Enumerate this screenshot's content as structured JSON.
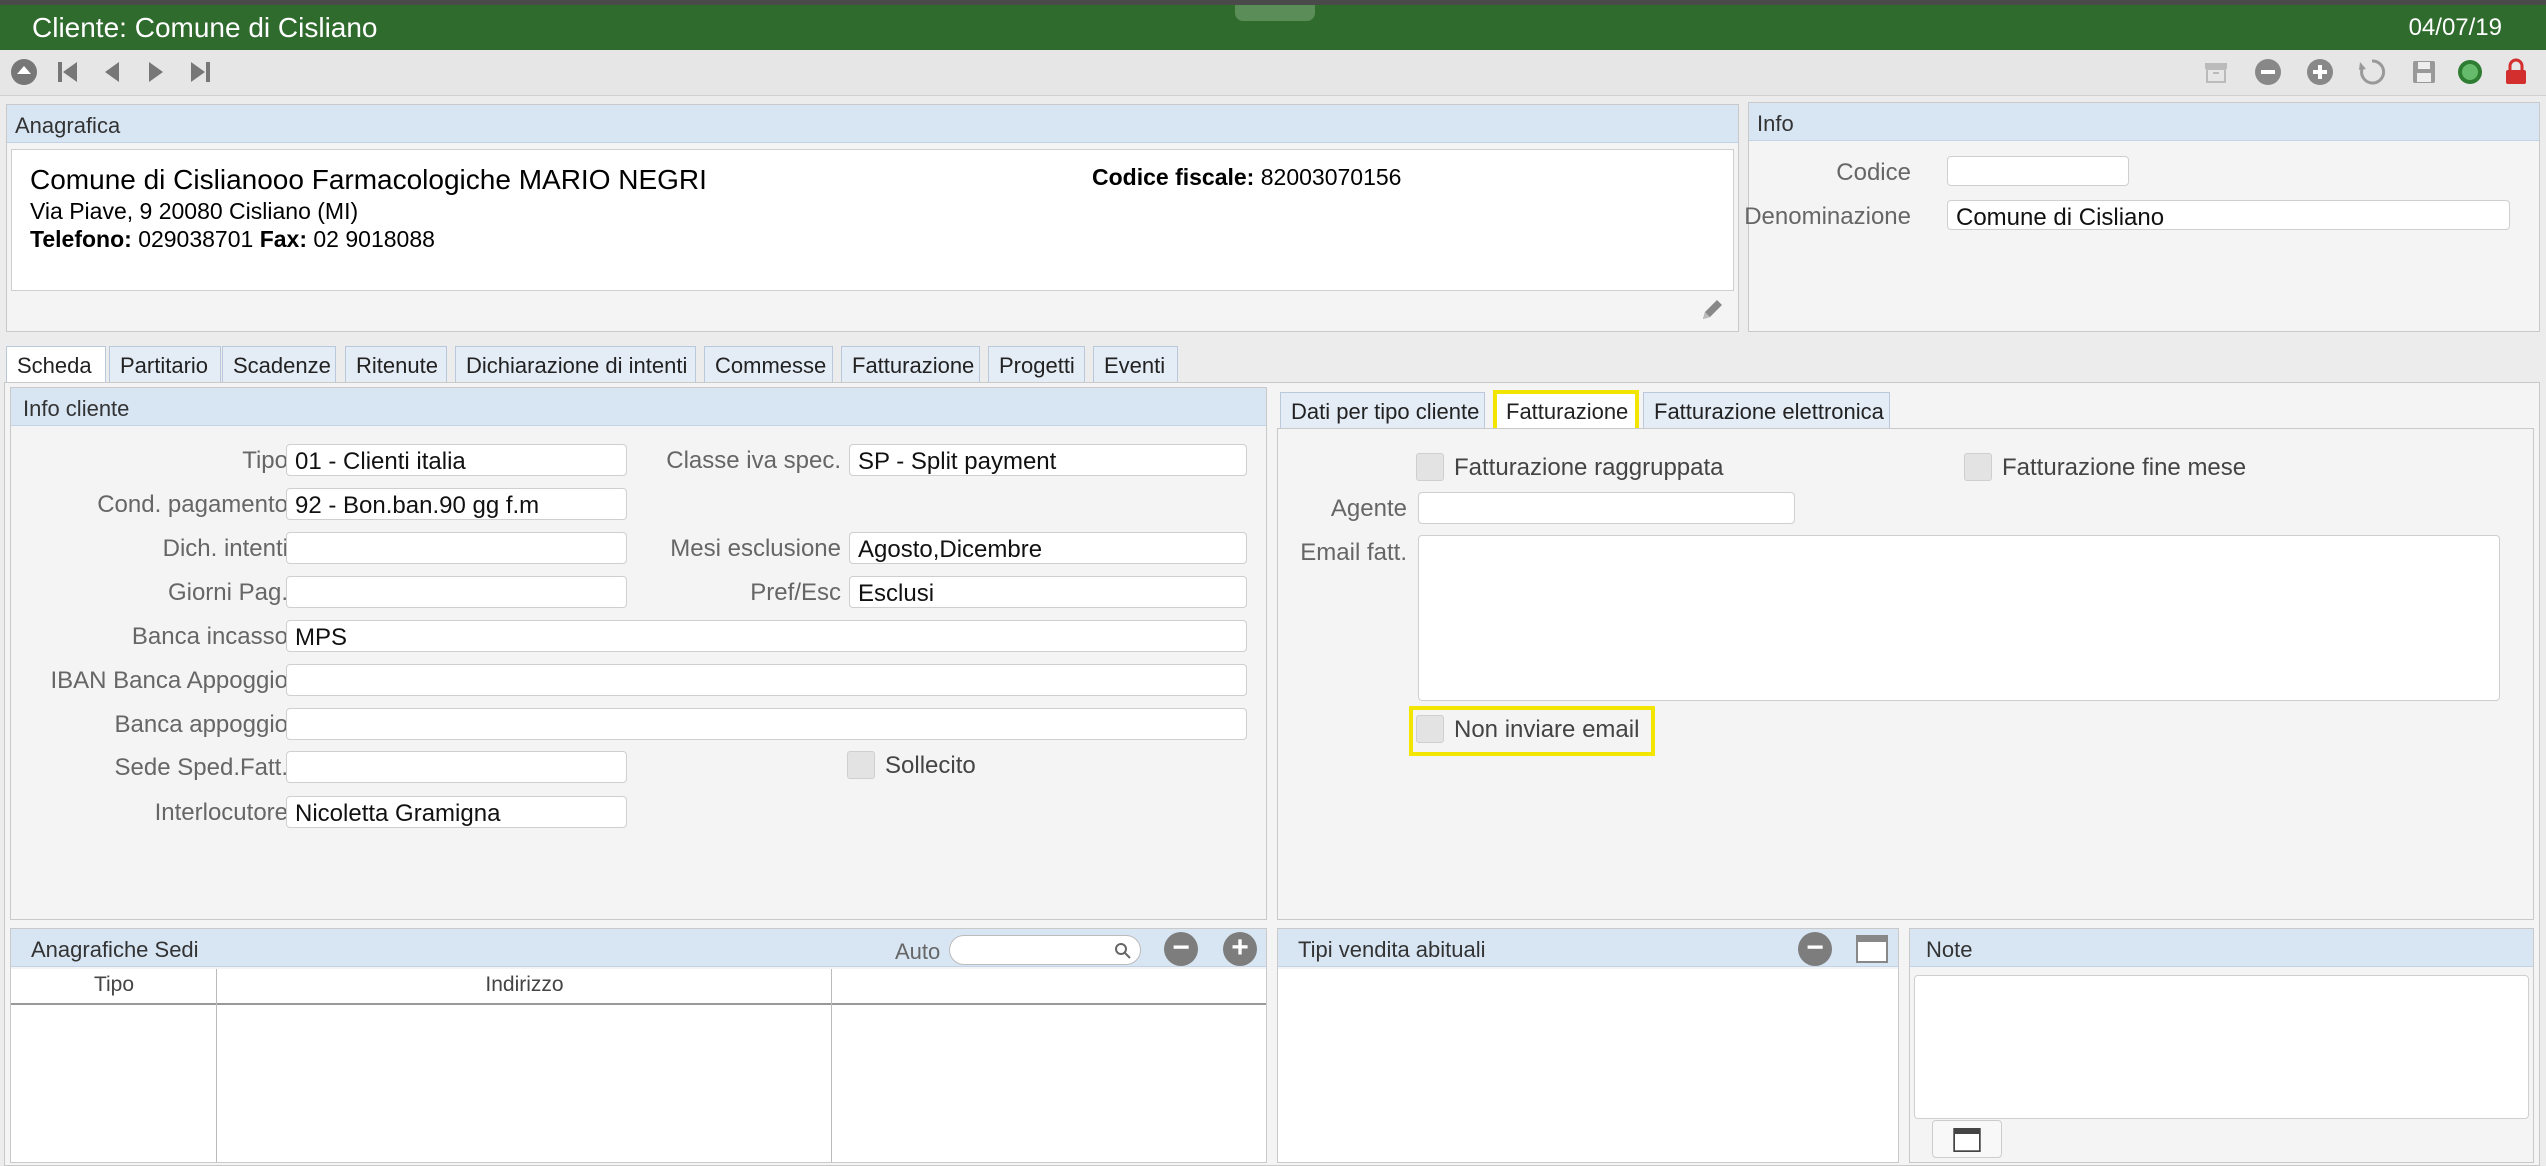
{
  "window": {
    "title": "Cliente: Comune di Cisliano",
    "date": "04/07/19"
  },
  "toolbar": {
    "nav_icons": [
      "home-icon",
      "first-record-icon",
      "previous-record-icon",
      "next-record-icon",
      "last-record-icon"
    ],
    "action_icons": [
      "archive-icon",
      "remove-icon",
      "add-icon",
      "refresh-icon",
      "save-icon",
      "status-icon",
      "lock-icon"
    ],
    "status_color": "#4caf50",
    "lock_color": "#d32f2f"
  },
  "anagrafica": {
    "header": "Anagrafica",
    "name": "Comune di Cislianooo Farmacologiche MARIO NEGRI",
    "address": "Via Piave, 9 20080 Cisliano (MI)",
    "tel_label": "Telefono:",
    "tel_value": "029038701",
    "fax_label": "Fax:",
    "fax_value": "02 9018088",
    "cf_label": "Codice fiscale:",
    "cf_value": "82003070156"
  },
  "info": {
    "header": "Info",
    "codice_label": "Codice",
    "codice_value": "",
    "denominazione_label": "Denominazione",
    "denominazione_value": "Comune di Cisliano"
  },
  "tabs": [
    "Scheda",
    "Partitario",
    "Scadenze",
    "Ritenute",
    "Dichiarazione di intenti",
    "Commesse",
    "Fatturazione",
    "Progetti",
    "Eventi"
  ],
  "info_cliente": {
    "header": "Info cliente",
    "tipo_label": "Tipo",
    "tipo_value": "01 - Clienti italia",
    "classe_label": "Classe iva spec.",
    "classe_value": "SP - Split payment",
    "cond_label": "Cond. pagamento",
    "cond_value": "92 - Bon.ban.90 gg f.m",
    "dich_label": "Dich. intenti",
    "dich_value": "",
    "mesi_label": "Mesi esclusione",
    "mesi_value": "Agosto,Dicembre",
    "giorni_label": "Giorni Pag.",
    "giorni_value": "",
    "pref_label": "Pref/Esc",
    "pref_value": "Esclusi",
    "banca_label": "Banca incasso",
    "banca_value": "MPS",
    "iban_label": "IBAN Banca Appoggio",
    "iban_value": "",
    "appoggio_label": "Banca appoggio",
    "appoggio_value": "",
    "sede_label": "Sede Sped.Fatt.",
    "sede_value": "",
    "sollecito_label": "Sollecito",
    "interlocutore_label": "Interlocutore",
    "interlocutore_value": "Nicoletta Gramigna"
  },
  "subtabs": [
    "Dati per tipo cliente",
    "Fatturazione",
    "Fatturazione elettronica"
  ],
  "fatturazione": {
    "raggruppata_label": "Fatturazione raggruppata",
    "fine_mese_label": "Fatturazione fine mese",
    "agente_label": "Agente",
    "agente_value": "",
    "email_label": "Email fatt.",
    "email_value": "",
    "non_inviare_label": "Non inviare email"
  },
  "sedi": {
    "header": "Anagrafiche Sedi",
    "auto_label": "Auto",
    "search_placeholder": "",
    "columns": [
      "Tipo",
      "Indirizzo",
      ""
    ]
  },
  "tipi_vendita": {
    "header": "Tipi vendita abituali"
  },
  "note": {
    "header": "Note",
    "value": ""
  },
  "highlight_color": "#f2e500"
}
